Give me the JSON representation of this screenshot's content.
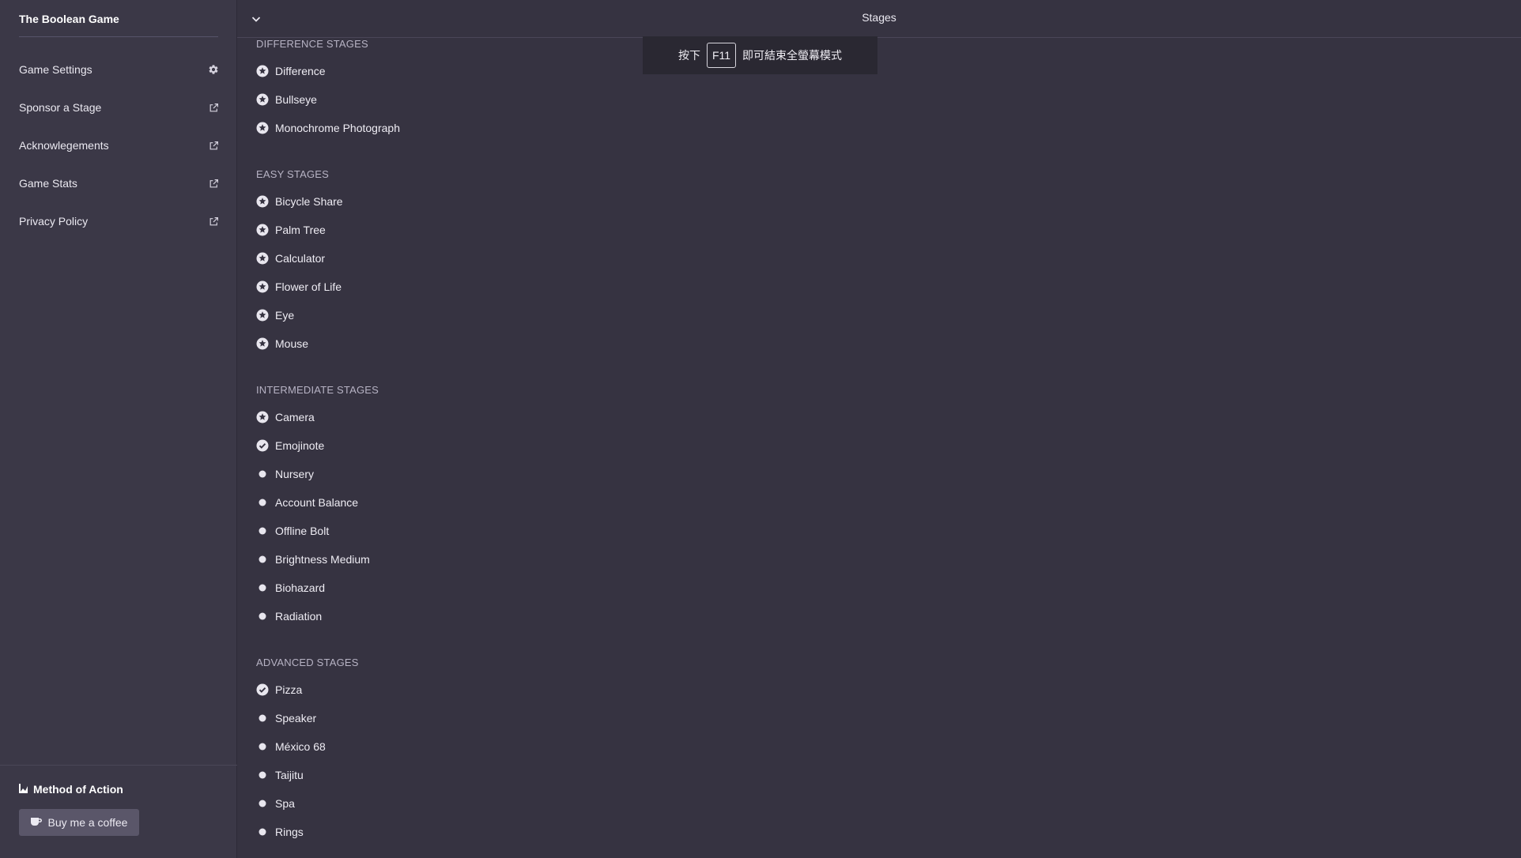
{
  "app": {
    "title": "The Boolean Game"
  },
  "header": {
    "title": "Stages"
  },
  "toast": {
    "before": "按下",
    "key": "F11",
    "after": "即可結束全螢幕模式"
  },
  "sidebar": {
    "items": [
      {
        "label": "Game Settings",
        "icon": "gear-icon"
      },
      {
        "label": "Sponsor a Stage",
        "icon": "external-link-icon"
      },
      {
        "label": "Acknowlegements",
        "icon": "external-link-icon"
      },
      {
        "label": "Game Stats",
        "icon": "external-link-icon"
      },
      {
        "label": "Privacy Policy",
        "icon": "external-link-icon"
      }
    ],
    "footer": {
      "brand": "Method of Action",
      "coffee_label": "Buy me a coffee"
    }
  },
  "sections": [
    {
      "heading": "DIFFERENCE STAGES",
      "items": [
        {
          "label": "Difference",
          "status": "star"
        },
        {
          "label": "Bullseye",
          "status": "star"
        },
        {
          "label": "Monochrome Photograph",
          "status": "star"
        }
      ]
    },
    {
      "heading": "EASY STAGES",
      "items": [
        {
          "label": "Bicycle Share",
          "status": "star"
        },
        {
          "label": "Palm Tree",
          "status": "star"
        },
        {
          "label": "Calculator",
          "status": "star"
        },
        {
          "label": "Flower of Life",
          "status": "star"
        },
        {
          "label": "Eye",
          "status": "star"
        },
        {
          "label": "Mouse",
          "status": "star"
        }
      ]
    },
    {
      "heading": "INTERMEDIATE STAGES",
      "items": [
        {
          "label": "Camera",
          "status": "star"
        },
        {
          "label": "Emojinote",
          "status": "check"
        },
        {
          "label": "Nursery",
          "status": "dot"
        },
        {
          "label": "Account Balance",
          "status": "dot"
        },
        {
          "label": "Offline Bolt",
          "status": "dot"
        },
        {
          "label": "Brightness Medium",
          "status": "dot"
        },
        {
          "label": "Biohazard",
          "status": "dot"
        },
        {
          "label": "Radiation",
          "status": "dot"
        }
      ]
    },
    {
      "heading": "ADVANCED STAGES",
      "items": [
        {
          "label": "Pizza",
          "status": "check"
        },
        {
          "label": "Speaker",
          "status": "dot"
        },
        {
          "label": "México 68",
          "status": "dot"
        },
        {
          "label": "Taijitu",
          "status": "dot"
        },
        {
          "label": "Spa",
          "status": "dot"
        },
        {
          "label": "Rings",
          "status": "dot"
        }
      ]
    }
  ]
}
